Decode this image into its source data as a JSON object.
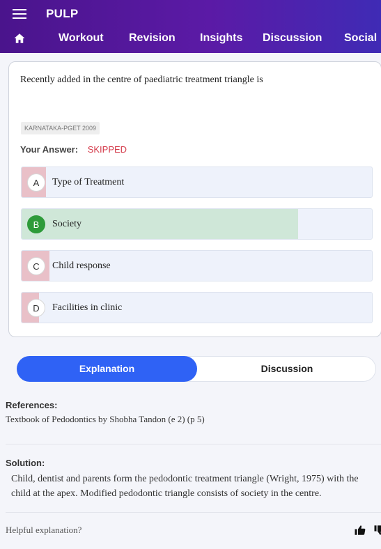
{
  "app": {
    "title": "PULP"
  },
  "nav": {
    "items": [
      "Workout",
      "Revision",
      "Insights",
      "Discussion",
      "Social"
    ]
  },
  "question": {
    "text": "Recently added in the centre of paediatric treatment triangle is",
    "tag": "KARNATAKA-PGET 2009",
    "your_answer_label": "Your Answer:",
    "your_answer_value": "SKIPPED",
    "options": [
      {
        "letter": "A",
        "text": "Type of Treatment",
        "percent": 7,
        "correct": false
      },
      {
        "letter": "B",
        "text": "Society",
        "percent": 79,
        "correct": true
      },
      {
        "letter": "C",
        "text": "Child response",
        "percent": 8,
        "correct": false
      },
      {
        "letter": "D",
        "text": "Facilities in clinic",
        "percent": 5,
        "correct": false
      }
    ]
  },
  "tabs": {
    "explanation": "Explanation",
    "discussion": "Discussion"
  },
  "explanation": {
    "references_label": "References:",
    "references_text": "Textbook of Pedodontics by Shobha Tandon (e 2) (p 5)",
    "solution_label": "Solution:",
    "solution_text": "Child, dentist and parents form the pedodontic treatment triangle (Wright, 1975) with the child at the apex. Modified pedodontic triangle consists of society in the centre.",
    "helpful_label": "Helpful explanation?"
  },
  "colors": {
    "header": "#4a148c",
    "accent": "#2f62f5",
    "correct_fill": "#cfe7d8",
    "wrong_fill": "#e9c0c8",
    "correct_badge": "#2e9b3a",
    "skipped": "#d43a4a"
  }
}
